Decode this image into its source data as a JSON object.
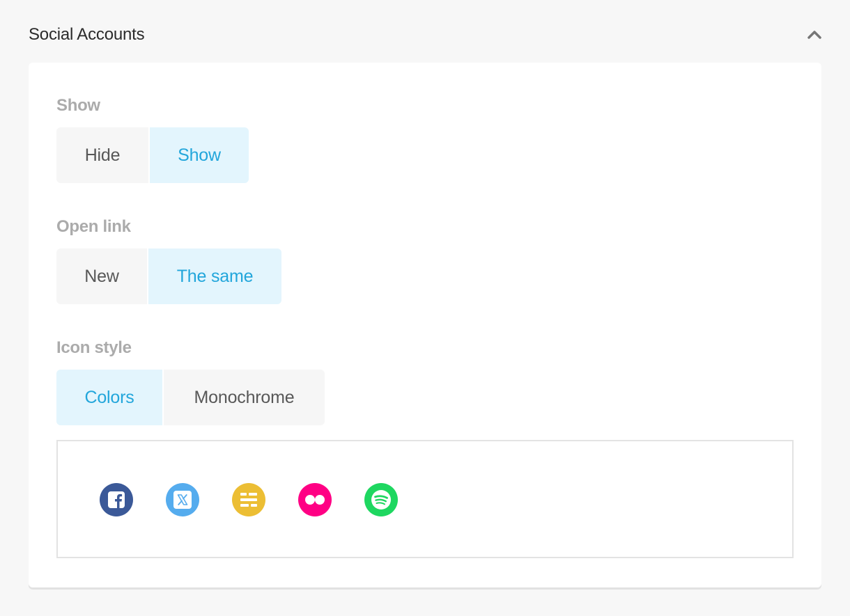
{
  "section": {
    "title": "Social Accounts"
  },
  "fields": {
    "show": {
      "label": "Show",
      "options": [
        "Hide",
        "Show"
      ],
      "selected": "Show"
    },
    "open_link": {
      "label": "Open link",
      "options": [
        "New",
        "The same"
      ],
      "selected": "The same"
    },
    "icon_style": {
      "label": "Icon style",
      "options": [
        "Colors",
        "Monochrome"
      ],
      "selected": "Colors"
    }
  },
  "preview": {
    "icons": [
      {
        "name": "facebook-icon",
        "color": "#3b5998"
      },
      {
        "name": "x-twitter-icon",
        "color": "#55acee"
      },
      {
        "name": "substack-icon",
        "color": "#ecbe34"
      },
      {
        "name": "flickr-icon",
        "color": "#ff0084"
      },
      {
        "name": "spotify-icon",
        "color": "#1ed760"
      }
    ]
  },
  "colors": {
    "accent": "#22a6db",
    "active_bg": "#e3f5fd"
  }
}
